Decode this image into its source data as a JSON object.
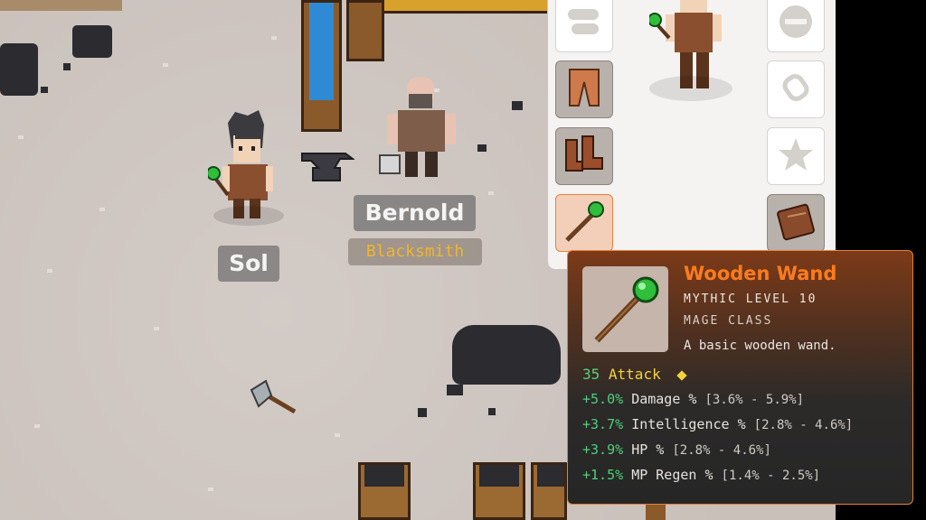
{
  "characters": [
    {
      "name": "Sol"
    },
    {
      "name": "Bernold",
      "title": "Blacksmith"
    }
  ],
  "equipment_slots": [
    {
      "slot": "gloves",
      "icon": "gloves-icon",
      "state": "empty"
    },
    {
      "slot": "legs",
      "icon": "leather-pants-icon",
      "state": "equipped"
    },
    {
      "slot": "boots",
      "icon": "leather-boots-icon",
      "state": "equipped"
    },
    {
      "slot": "weapon",
      "icon": "wooden-wand-icon",
      "state": "selected"
    },
    {
      "slot": "shield",
      "icon": "shield-slot-icon",
      "state": "empty"
    },
    {
      "slot": "ring",
      "icon": "ring-slot-icon",
      "state": "empty"
    },
    {
      "slot": "trinket",
      "icon": "star-slot-icon",
      "state": "empty"
    },
    {
      "slot": "book",
      "icon": "spellbook-icon",
      "state": "equipped"
    }
  ],
  "tooltip": {
    "name": "Wooden Wand",
    "rarity": "MYTHIC LEVEL 10",
    "class": "MAGE CLASS",
    "description": "A basic wooden wand.",
    "attack": {
      "value": "35",
      "label": "Attack"
    },
    "stats": [
      {
        "bonus": "+5.0%",
        "name": "Damage %",
        "range": "[3.6% - 5.9%]"
      },
      {
        "bonus": "+3.7%",
        "name": "Intelligence %",
        "range": "[2.8% - 4.6%]"
      },
      {
        "bonus": "+3.9%",
        "name": "HP %",
        "range": "[2.8% - 4.6%]"
      },
      {
        "bonus": "+1.5%",
        "name": "MP Regen %",
        "range": "[1.4% - 2.5%]"
      }
    ]
  },
  "colors": {
    "rarity_mythic": "#ff7b1e",
    "stat_bonus": "#4ed079",
    "attack": "#f4d33a",
    "npc_title": "#f2b52a"
  }
}
